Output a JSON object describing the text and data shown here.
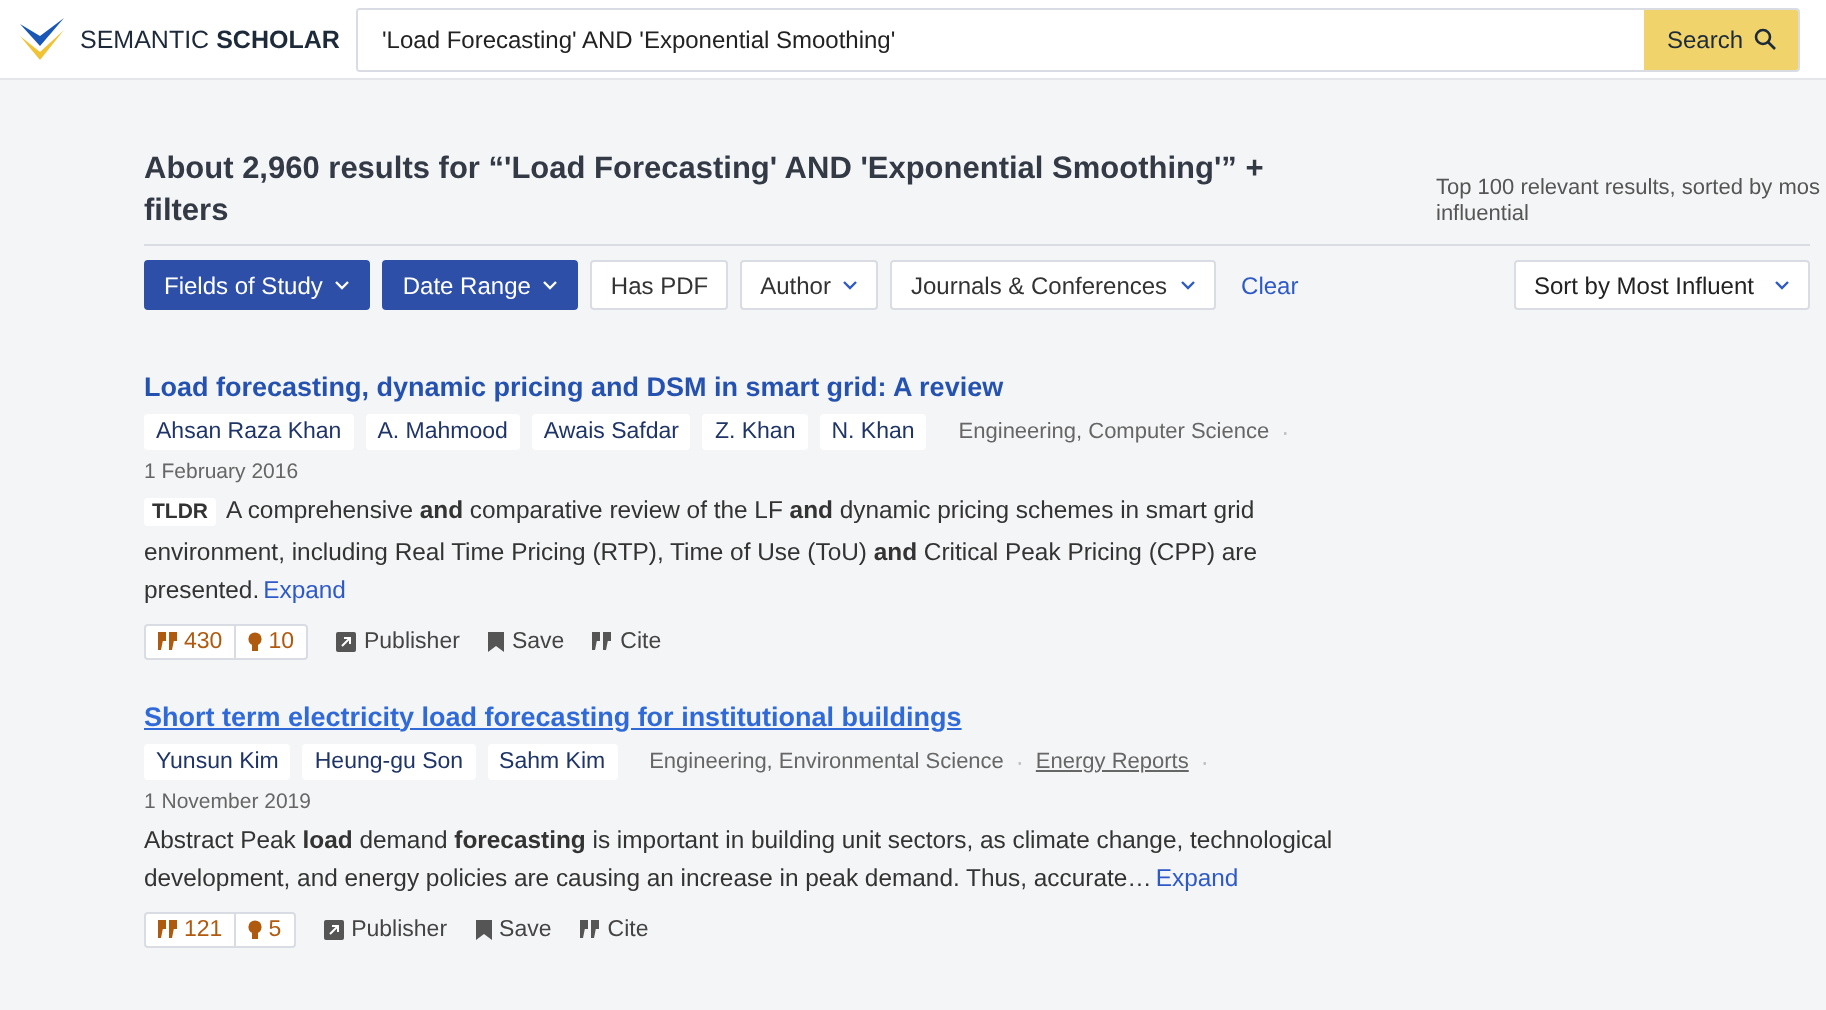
{
  "header": {
    "brand_light": "SEMANTIC",
    "brand_bold": "SCHOLAR",
    "search_value": "'Load Forecasting' AND 'Exponential Smoothing'",
    "search_button": "Search"
  },
  "results_heading": "About 2,960 results for “'Load Forecasting' AND 'Exponential Smoothing'” + filters",
  "sort_note": "Top 100 relevant results, sorted by mos\ninfluential",
  "filters": [
    {
      "label": "Fields of Study",
      "active": true,
      "dropdown": true
    },
    {
      "label": "Date Range",
      "active": true,
      "dropdown": true
    },
    {
      "label": "Has PDF",
      "active": false,
      "dropdown": false
    },
    {
      "label": "Author",
      "active": false,
      "dropdown": true
    },
    {
      "label": "Journals & Conferences",
      "active": false,
      "dropdown": true
    }
  ],
  "clear_label": "Clear",
  "sort_select": "Sort by Most Influent",
  "papers": [
    {
      "title": "Load forecasting, dynamic pricing and DSM in smart grid: A review",
      "hovered": false,
      "authors": [
        "Ahsan Raza Khan",
        "A. Mahmood",
        "Awais Safdar",
        "Z. Khan",
        "N. Khan"
      ],
      "fields": "Engineering, Computer Science",
      "separator": "·",
      "date": "1 February 2016",
      "tldr": "TLDR",
      "abstract": "A comprehensive **and** comparative review of the LF **and** dynamic pricing schemes in smart grid environment, including Real Time Pricing (RTP), Time of Use (ToU) **and** Critical Peak Pricing (CPP) are presented.",
      "expand": "Expand",
      "citations": "430",
      "influential": "10",
      "actions": [
        "Publisher",
        "Save",
        "Cite"
      ]
    },
    {
      "title": "Short term electricity load forecasting for institutional buildings",
      "hovered": true,
      "authors": [
        "Yunsun Kim",
        "Heung-gu Son",
        "Sahm Kim"
      ],
      "fields": "Engineering, Environmental Science",
      "separator": "·",
      "venue": "Energy Reports",
      "date": "1 November 2019",
      "abstract": "Abstract Peak **load** demand **forecasting** is important in building unit sectors, as climate change, technological development, and energy policies are causing an increase in peak demand. Thus, accurate…",
      "expand": "Expand",
      "citations": "121",
      "influential": "5",
      "actions": [
        "Publisher",
        "Save",
        "Cite"
      ]
    }
  ]
}
